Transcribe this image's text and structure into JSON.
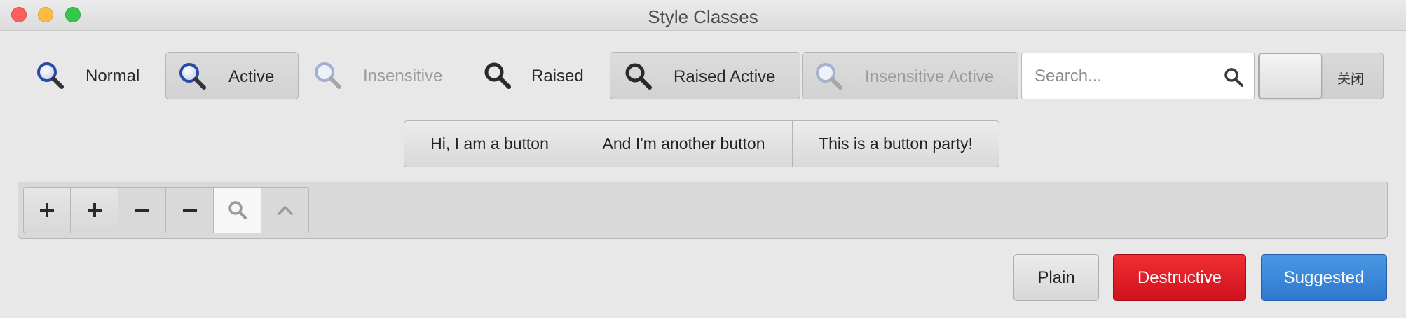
{
  "window": {
    "title": "Style Classes"
  },
  "toolbar": {
    "items": [
      {
        "label": "Normal",
        "icon": "search-icon"
      },
      {
        "label": "Active",
        "icon": "search-icon"
      },
      {
        "label": "Insensitive",
        "icon": "search-icon"
      },
      {
        "label": "Raised",
        "icon": "search-icon"
      },
      {
        "label": "Raised Active",
        "icon": "search-icon"
      },
      {
        "label": "Insensitive Active",
        "icon": "search-icon"
      }
    ],
    "search": {
      "placeholder": "Search...",
      "value": ""
    },
    "switch": {
      "state_label": "关闭"
    }
  },
  "linked_buttons": [
    {
      "label": "Hi, I am a button"
    },
    {
      "label": "And I'm another button"
    },
    {
      "label": "This is a button party!"
    }
  ],
  "inline_toolbar": {
    "buttons": [
      {
        "icon": "plus-icon"
      },
      {
        "icon": "plus-icon"
      },
      {
        "icon": "minus-icon"
      },
      {
        "icon": "minus-icon"
      },
      {
        "icon": "search-icon"
      },
      {
        "icon": "chevron-up-icon"
      }
    ]
  },
  "actions": {
    "plain": "Plain",
    "destructive": "Destructive",
    "suggested": "Suggested"
  },
  "colors": {
    "destructive": "#d81b24",
    "suggested": "#3d87d8",
    "close": "#fc605c",
    "minimize": "#fdbc40",
    "maximize": "#34c84a"
  }
}
